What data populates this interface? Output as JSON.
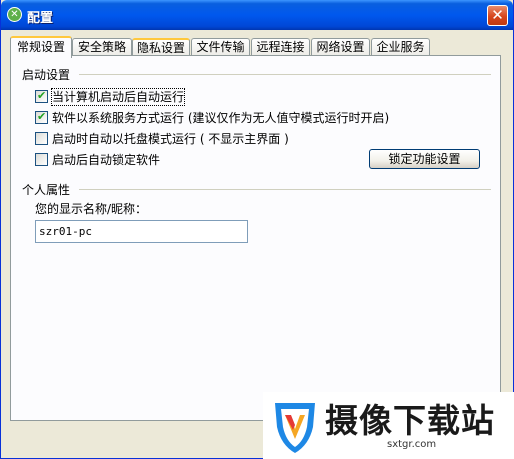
{
  "window": {
    "title": "配置",
    "close_glyph": "✕"
  },
  "tabs": [
    {
      "label": "常规设置",
      "active": true
    },
    {
      "label": "安全策略",
      "active": false
    },
    {
      "label": "隐私设置",
      "active": false
    },
    {
      "label": "文件传输",
      "active": false
    },
    {
      "label": "远程连接",
      "active": false
    },
    {
      "label": "网络设置",
      "active": false
    },
    {
      "label": "企业服务",
      "active": false
    }
  ],
  "startup": {
    "title": "启动设置",
    "options": [
      {
        "label": "当计算机启动后自动运行",
        "checked": true
      },
      {
        "label": "软件以系统服务方式运行 (建议仅作为无人值守模式运行时开启)",
        "checked": true
      },
      {
        "label": "启动时自动以托盘模式运行 ( 不显示主界面 )",
        "checked": false
      },
      {
        "label": "启动后自动锁定软件",
        "checked": false
      }
    ],
    "lock_button": "锁定功能设置"
  },
  "personal": {
    "title": "个人属性",
    "display_name_label": "您的显示名称/昵称：",
    "display_name_value": "szr01-pc"
  },
  "watermark": {
    "text": "摄像下载站",
    "url": "sxtgr.com"
  }
}
